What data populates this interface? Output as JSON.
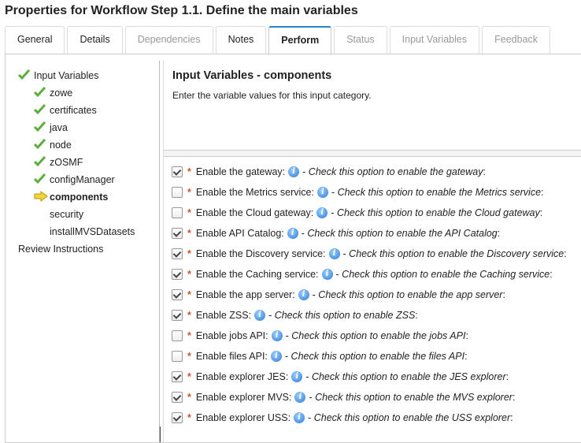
{
  "title": "Properties for Workflow Step 1.1. Define the main variables",
  "tabs": [
    {
      "label": "General",
      "state": "normal"
    },
    {
      "label": "Details",
      "state": "normal"
    },
    {
      "label": "Dependencies",
      "state": "disabled"
    },
    {
      "label": "Notes",
      "state": "normal"
    },
    {
      "label": "Perform",
      "state": "active"
    },
    {
      "label": "Status",
      "state": "disabled"
    },
    {
      "label": "Input Variables",
      "state": "disabled"
    },
    {
      "label": "Feedback",
      "state": "disabled"
    }
  ],
  "nav": [
    {
      "label": "Input Variables",
      "icon": "check-icon",
      "level": 0
    },
    {
      "label": "zowe",
      "icon": "check-icon",
      "level": 1
    },
    {
      "label": "certificates",
      "icon": "check-icon",
      "level": 1
    },
    {
      "label": "java",
      "icon": "check-icon",
      "level": 1
    },
    {
      "label": "node",
      "icon": "check-icon",
      "level": 1
    },
    {
      "label": "zOSMF",
      "icon": "check-icon",
      "level": 1
    },
    {
      "label": "configManager",
      "icon": "check-icon",
      "level": 1
    },
    {
      "label": "components",
      "icon": "arrow-right-icon",
      "level": 1,
      "current": true
    },
    {
      "label": "security",
      "icon": "",
      "level": 1
    },
    {
      "label": "installMVSDatasets",
      "icon": "",
      "level": 1
    },
    {
      "label": "Review Instructions",
      "icon": "",
      "level": 0
    }
  ],
  "main": {
    "heading": "Input Variables - components",
    "description": "Enter the variable values for this input category.",
    "options": [
      {
        "label": "Enable the gateway:",
        "hint": "Check this option to enable the gateway",
        "checked": true
      },
      {
        "label": "Enable the Metrics service:",
        "hint": "Check this option to enable the Metrics service",
        "checked": false
      },
      {
        "label": "Enable the Cloud gateway:",
        "hint": "Check this option to enable the Cloud gateway",
        "checked": false
      },
      {
        "label": "Enable API Catalog:",
        "hint": "Check this option to enable the API Catalog",
        "checked": true
      },
      {
        "label": "Enable the Discovery service:",
        "hint": "Check this option to enable the Discovery service",
        "checked": true
      },
      {
        "label": "Enable the Caching service:",
        "hint": "Check this option to enable the Caching service",
        "checked": true
      },
      {
        "label": "Enable the app server:",
        "hint": "Check this option to enable the app server",
        "checked": true
      },
      {
        "label": "Enable ZSS:",
        "hint": "Check this option to enable ZSS",
        "checked": true
      },
      {
        "label": "Enable jobs API:",
        "hint": "Check this option to enable the jobs API",
        "checked": false
      },
      {
        "label": "Enable files API:",
        "hint": "Check this option to enable the files API",
        "checked": false
      },
      {
        "label": "Enable explorer JES:",
        "hint": "Check this option to enable the JES explorer",
        "checked": true
      },
      {
        "label": "Enable explorer MVS:",
        "hint": "Check this option to enable the MVS explorer",
        "checked": true
      },
      {
        "label": "Enable explorer USS:",
        "hint": "Check this option to enable the USS explorer",
        "checked": true
      }
    ]
  },
  "colors": {
    "accent": "#1a87c9",
    "required": "#d2532a",
    "check": "#5cae3c",
    "arrow": "#f2d43a"
  }
}
